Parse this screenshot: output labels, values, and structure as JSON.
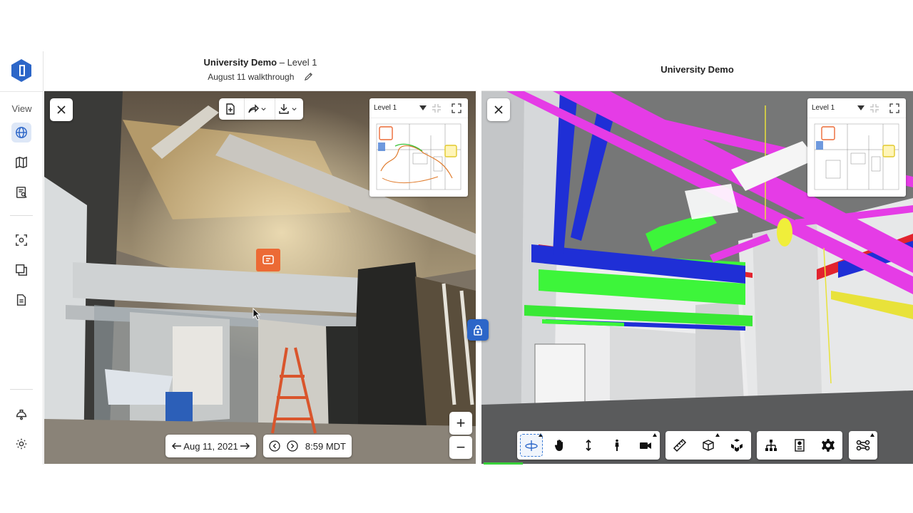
{
  "header_left": {
    "project_name": "University Demo",
    "separator": "–",
    "level": "Level 1",
    "walkthrough": "August 11 walkthrough"
  },
  "header_right": {
    "title": "University Demo"
  },
  "sidebar": {
    "view_label": "View",
    "items": [
      {
        "name": "globe-icon",
        "active": true
      },
      {
        "name": "map-icon",
        "active": false
      },
      {
        "name": "report-icon",
        "active": false
      },
      {
        "name": "capture-icon",
        "active": false
      },
      {
        "name": "layers-icon",
        "active": false
      },
      {
        "name": "document-icon",
        "active": false
      },
      {
        "name": "hardhat-icon",
        "active": false
      },
      {
        "name": "gear-icon",
        "active": false
      }
    ]
  },
  "left_pane": {
    "minimap_level": "Level 1",
    "date": "Aug 11, 2021",
    "time": "8:59 MDT",
    "zoom_in": "+",
    "zoom_out": "−"
  },
  "right_pane": {
    "minimap_level": "Level 1",
    "toolbar_groups": [
      [
        "orbit-icon",
        "pan-hand-icon",
        "elevate-icon",
        "walk-person-icon",
        "camera-icon"
      ],
      [
        "measure-ruler-icon",
        "section-box-icon",
        "explode-cubes-icon"
      ],
      [
        "model-tree-icon",
        "properties-icon",
        "settings-gear-icon"
      ],
      [
        "nodes-icon"
      ]
    ]
  },
  "colors": {
    "brand": "#2c66c8",
    "pin_orange": "#ec6a35",
    "pipe_magenta": "#e53ce6",
    "pipe_blue": "#1f2fd6",
    "duct_green": "#3df53a",
    "pipe_red": "#e2232e",
    "pipe_yellow": "#e8e23a"
  }
}
